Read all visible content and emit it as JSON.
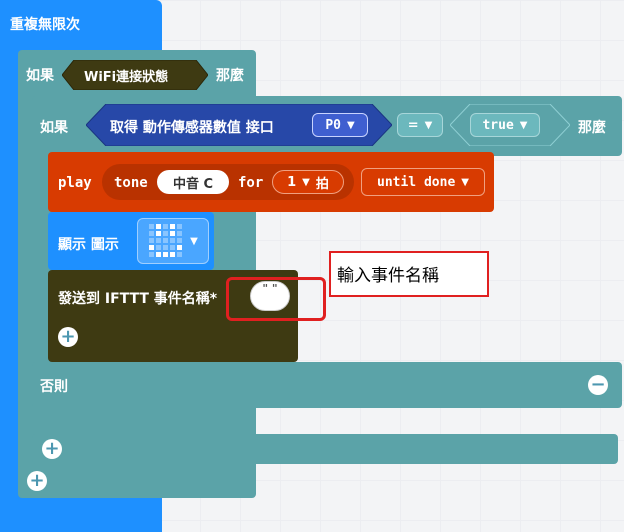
{
  "colors": {
    "loop": "#1e90ff",
    "logic": "#5ba3a8",
    "music": "#d83b01",
    "basic": "#1e90ff",
    "ifttt": "#3e3a12",
    "annotation": "#e02020"
  },
  "loop": {
    "label": "重複無限次"
  },
  "outer_if": {
    "if_label": "如果",
    "condition": "WiFi連接狀態",
    "then_label": "那麼"
  },
  "inner_if": {
    "if_label": "如果",
    "sensor": "取得 動作傳感器數值 接口",
    "pin": "P0",
    "operator": "=",
    "compare_value": "true",
    "then_label": "那麼",
    "else_label": "否則"
  },
  "play": {
    "play_label": "play",
    "tone_label": "tone",
    "note": "中音 C",
    "for_label": "for",
    "beats": "1",
    "beat_unit": "拍",
    "mode": "until done"
  },
  "show": {
    "label": "顯示 圖示"
  },
  "ifttt": {
    "label": "發送到 IFTTT 事件名稱*",
    "event_value": "\" \""
  },
  "annotation": {
    "text": "輸入事件名稱"
  }
}
